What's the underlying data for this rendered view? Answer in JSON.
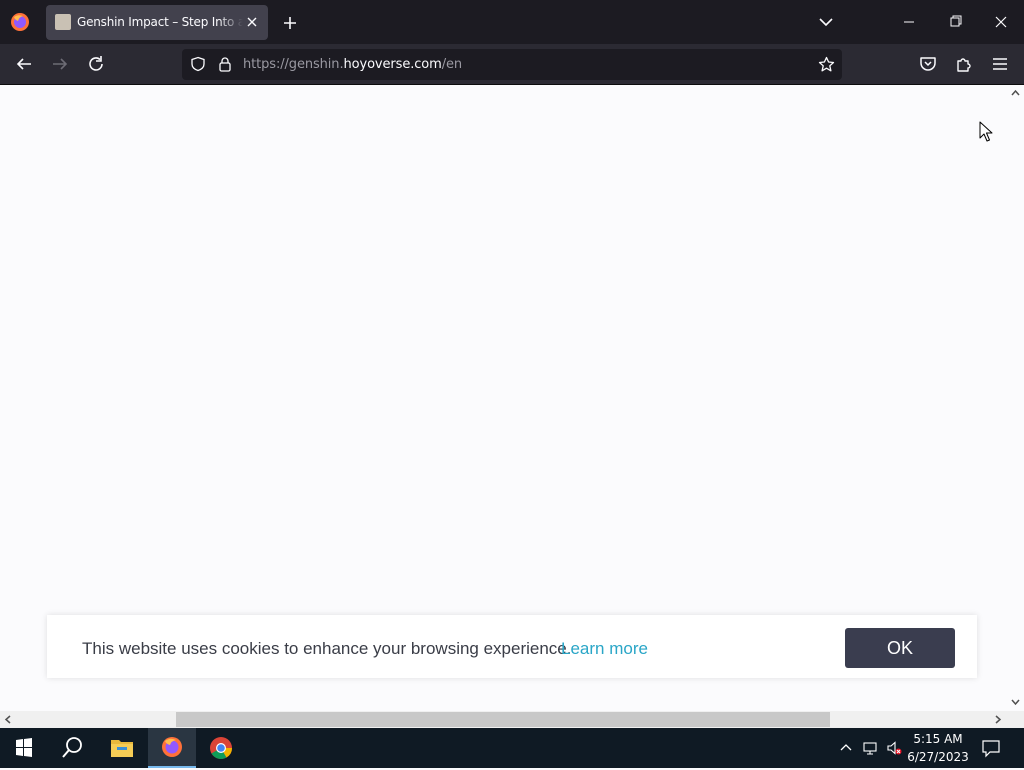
{
  "browser": {
    "tab": {
      "title": "Genshin Impact – Step Into a Vast Magical World of Adventure"
    },
    "url": {
      "prefix": "https://genshin.",
      "domain": "hoyoverse.com",
      "path": "/en"
    }
  },
  "cookie_banner": {
    "message": "This website uses cookies to enhance your browsing experience.",
    "learn_more": "Learn more",
    "ok_label": "OK"
  },
  "taskbar": {
    "time": "5:15 AM",
    "date": "6/27/2023"
  },
  "colors": {
    "accent_link": "#2aa6c7",
    "ok_button": "#3a3d4f",
    "browser_chrome": "#1c1b22"
  },
  "icons": [
    "firefox-icon",
    "close-icon",
    "plus-icon",
    "chevron-down-icon",
    "back-icon",
    "forward-icon",
    "reload-icon",
    "shield-icon",
    "lock-icon",
    "star-icon",
    "pocket-icon",
    "extensions-icon",
    "menu-icon",
    "windows-start-icon",
    "search-icon",
    "file-explorer-icon",
    "chrome-icon"
  ]
}
